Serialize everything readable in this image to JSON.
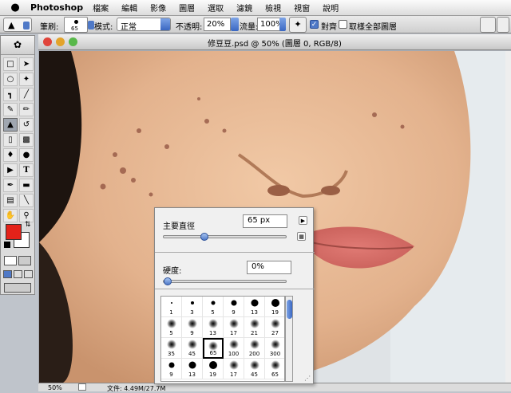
{
  "menubar": {
    "apple": "",
    "app_name": "Photoshop",
    "items": [
      "檔案",
      "編輯",
      "影像",
      "圖層",
      "選取",
      "濾鏡",
      "檢視",
      "視窗",
      "說明"
    ]
  },
  "options": {
    "brush_label": "筆刷:",
    "brush_size": "65",
    "mode_label": "模式:",
    "mode_value": "正常",
    "opacity_label": "不透明:",
    "opacity_value": "20%",
    "flow_label": "流量:",
    "flow_value": "100%",
    "aligned_label": "對齊",
    "aligned_checked": true,
    "sample_all_label": "取樣全部圖層",
    "sample_all_checked": false
  },
  "document": {
    "title": "修豆豆.psd @ 50% (圖層 0, RGB/8)",
    "zoom": "50%",
    "doc_info": "文件: 4.49M/27.7M"
  },
  "brush_panel": {
    "diameter_label": "主要直徑",
    "diameter_value": "65 px",
    "diameter_fraction": 0.32,
    "hardness_label": "硬度:",
    "hardness_value": "0%",
    "hardness_fraction": 0.0,
    "presets": [
      {
        "size": "1",
        "type": "hard"
      },
      {
        "size": "3",
        "type": "hard"
      },
      {
        "size": "5",
        "type": "hard"
      },
      {
        "size": "9",
        "type": "hard"
      },
      {
        "size": "13",
        "type": "hard"
      },
      {
        "size": "19",
        "type": "hard"
      },
      {
        "size": "5",
        "type": "soft"
      },
      {
        "size": "9",
        "type": "soft"
      },
      {
        "size": "13",
        "type": "soft"
      },
      {
        "size": "17",
        "type": "soft"
      },
      {
        "size": "21",
        "type": "soft"
      },
      {
        "size": "27",
        "type": "soft"
      },
      {
        "size": "35",
        "type": "soft"
      },
      {
        "size": "45",
        "type": "soft"
      },
      {
        "size": "65",
        "type": "soft",
        "selected": true
      },
      {
        "size": "100",
        "type": "soft"
      },
      {
        "size": "200",
        "type": "soft"
      },
      {
        "size": "300",
        "type": "soft"
      },
      {
        "size": "9",
        "type": "hard"
      },
      {
        "size": "13",
        "type": "hard"
      },
      {
        "size": "19",
        "type": "hard"
      },
      {
        "size": "17",
        "type": "soft"
      },
      {
        "size": "45",
        "type": "soft"
      },
      {
        "size": "65",
        "type": "soft"
      }
    ]
  },
  "toolbox": {
    "tools": [
      "marquee-tool",
      "move-tool",
      "lasso-tool",
      "magic-wand-tool",
      "crop-tool",
      "slice-tool",
      "healing-brush-tool",
      "brush-tool",
      "clone-stamp-tool",
      "history-brush-tool",
      "eraser-tool",
      "gradient-tool",
      "blur-tool",
      "dodge-tool",
      "path-selection-tool",
      "type-tool",
      "pen-tool",
      "shape-tool",
      "notes-tool",
      "eyedropper-tool",
      "hand-tool",
      "zoom-tool"
    ],
    "foreground_color": "#e32219",
    "background_color": "#ffffff"
  }
}
